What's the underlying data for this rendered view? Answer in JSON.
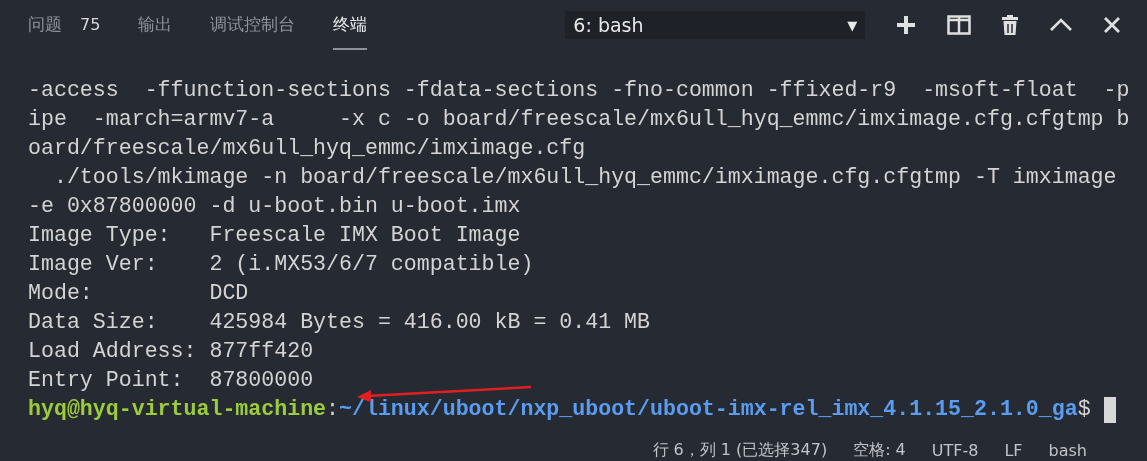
{
  "panel_tabs": [
    {
      "label": "问题",
      "badge": "75",
      "selected": false
    },
    {
      "label": "输出",
      "selected": false
    },
    {
      "label": "调试控制台",
      "selected": false
    },
    {
      "label": "终端",
      "selected": true
    }
  ],
  "terminal_select": {
    "value": "6: bash",
    "caret": "▼"
  },
  "terminal_lines": [
    "-access  -ffunction-sections -fdata-sections -fno-common -ffixed-r9  -msoft-float  -p",
    "ipe  -march=armv7-a     -x c -o board/freescale/mx6ull_hyq_emmc/imximage.cfg.cfgtmp b",
    "oard/freescale/mx6ull_hyq_emmc/imximage.cfg",
    "  ./tools/mkimage -n board/freescale/mx6ull_hyq_emmc/imximage.cfg.cfgtmp -T imximage",
    "-e 0x87800000 -d u-boot.bin u-boot.imx",
    "Image Type:   Freescale IMX Boot Image",
    "Image Ver:    2 (i.MX53/6/7 compatible)",
    "Mode:         DCD",
    "Data Size:    425984 Bytes = 416.00 kB = 0.41 MB",
    "Load Address: 877ff420",
    "Entry Point:  87800000"
  ],
  "prompt": {
    "user_host": "hyq@hyq-virtual-machine",
    "separator": ":",
    "path": "~/linux/uboot/nxp_uboot/uboot-imx-rel_imx_4.1.15_2.1.0_ga",
    "symbol": "$"
  },
  "status_bar": [
    "行 6，列 1 (已选择347)",
    "空格: 4",
    "UTF-8",
    "LF",
    "bash"
  ]
}
